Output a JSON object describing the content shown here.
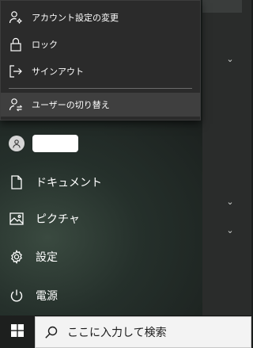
{
  "flyout": {
    "items": [
      {
        "label": "アカウント設定の変更",
        "icon": "account-settings-icon"
      },
      {
        "label": "ロック",
        "icon": "lock-icon"
      },
      {
        "label": "サインアウト",
        "icon": "sign-out-icon"
      },
      {
        "label": "ユーザーの切り替え",
        "icon": "switch-user-icon"
      }
    ]
  },
  "user": {
    "icon": "avatar-icon"
  },
  "nav": {
    "items": [
      {
        "label": "ドキュメント",
        "icon": "document-icon"
      },
      {
        "label": "ピクチャ",
        "icon": "picture-icon"
      },
      {
        "label": "設定",
        "icon": "gear-icon"
      },
      {
        "label": "電源",
        "icon": "power-icon"
      }
    ]
  },
  "taskbar": {
    "search": {
      "placeholder": "ここに入力して検索",
      "icon": "search-icon"
    },
    "start_icon": "windows-logo-icon"
  },
  "colors": {
    "flyout_bg": "#2b2b2b",
    "flyout_hover": "#3f3f3f",
    "start_bg": "#25302b",
    "taskbar_bg": "#101211",
    "search_bg": "#f3f3f3"
  }
}
